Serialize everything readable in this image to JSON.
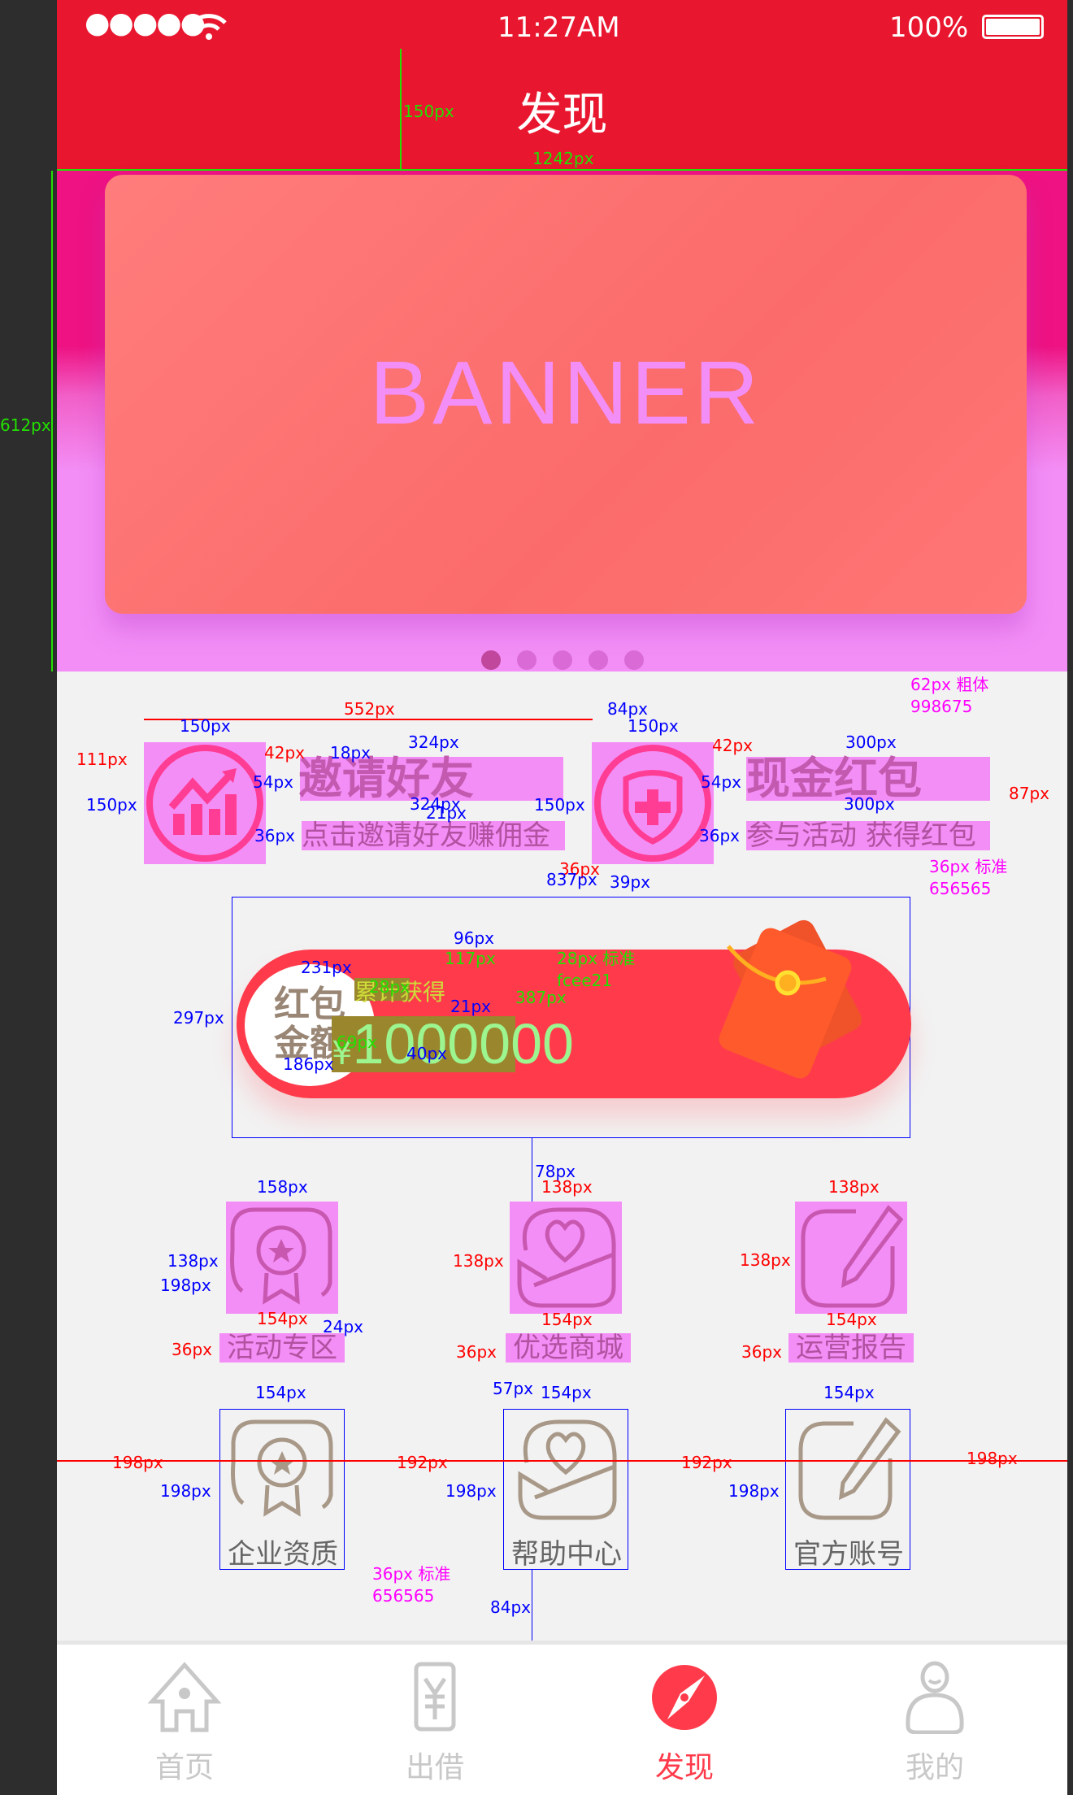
{
  "status_bar": {
    "signal": "●●●●●",
    "time": "11:27AM",
    "battery": "100%"
  },
  "header": {
    "title": "发现"
  },
  "banner": {
    "text": "BANNER",
    "dots": 5,
    "active_dot": 0
  },
  "features": [
    {
      "title": "邀请好友",
      "subtitle": "点击邀请好友赚佣金",
      "icon": "chart-up-icon"
    },
    {
      "title": "现金红包",
      "subtitle": "参与活动 获得红包",
      "icon": "shield-cross-icon"
    }
  ],
  "red_packet": {
    "badge_line1": "红包",
    "badge_line2": "金额",
    "label": "累计获得",
    "currency": "¥",
    "amount": "1000000"
  },
  "grid": [
    {
      "label": "活动专区",
      "icon": "medal-icon"
    },
    {
      "label": "优选商城",
      "icon": "heart-envelope-icon"
    },
    {
      "label": "运营报告",
      "icon": "edit-icon"
    },
    {
      "label": "企业资质",
      "icon": "medal-icon"
    },
    {
      "label": "帮助中心",
      "icon": "heart-envelope-icon"
    },
    {
      "label": "官方账号",
      "icon": "edit-icon"
    }
  ],
  "tabs": [
    {
      "label": "首页",
      "icon": "home-icon",
      "active": false
    },
    {
      "label": "出借",
      "icon": "yen-icon",
      "active": false
    },
    {
      "label": "发现",
      "icon": "compass-icon",
      "active": true
    },
    {
      "label": "我的",
      "icon": "user-icon",
      "active": false
    }
  ],
  "colors": {
    "header": "#e8172f",
    "accent": "#ff3b4b",
    "title_text": "#998675",
    "body_text": "#656565",
    "amount_text": "#fcee21"
  },
  "annotations": [
    "150px",
    "1242px",
    "612px",
    "552px",
    "150px",
    "111px",
    "42px",
    "18px",
    "324px",
    "54px",
    "150px",
    "324px",
    "21px",
    "150px",
    "36px",
    "36px",
    "837px",
    "39px",
    "84px",
    "150px",
    "42px",
    "300px",
    "62px 粗体",
    "998675",
    "54px",
    "300px",
    "87px",
    "36px",
    "36px 标准",
    "656565",
    "96px",
    "117px",
    "28px 标准",
    "fcee21",
    "231px",
    "28px",
    "387px",
    "21px",
    "297px",
    "69px",
    "40px",
    "186px",
    "78px",
    "138px",
    "158px",
    "138px",
    "138px",
    "198px",
    "24px",
    "154px",
    "36px",
    "138px",
    "154px",
    "36px",
    "138px",
    "154px",
    "36px",
    "154px",
    "57px",
    "154px",
    "154px",
    "198px",
    "192px",
    "192px",
    "198px",
    "198px",
    "198px",
    "198px",
    "36px 标准",
    "656565",
    "84px"
  ]
}
